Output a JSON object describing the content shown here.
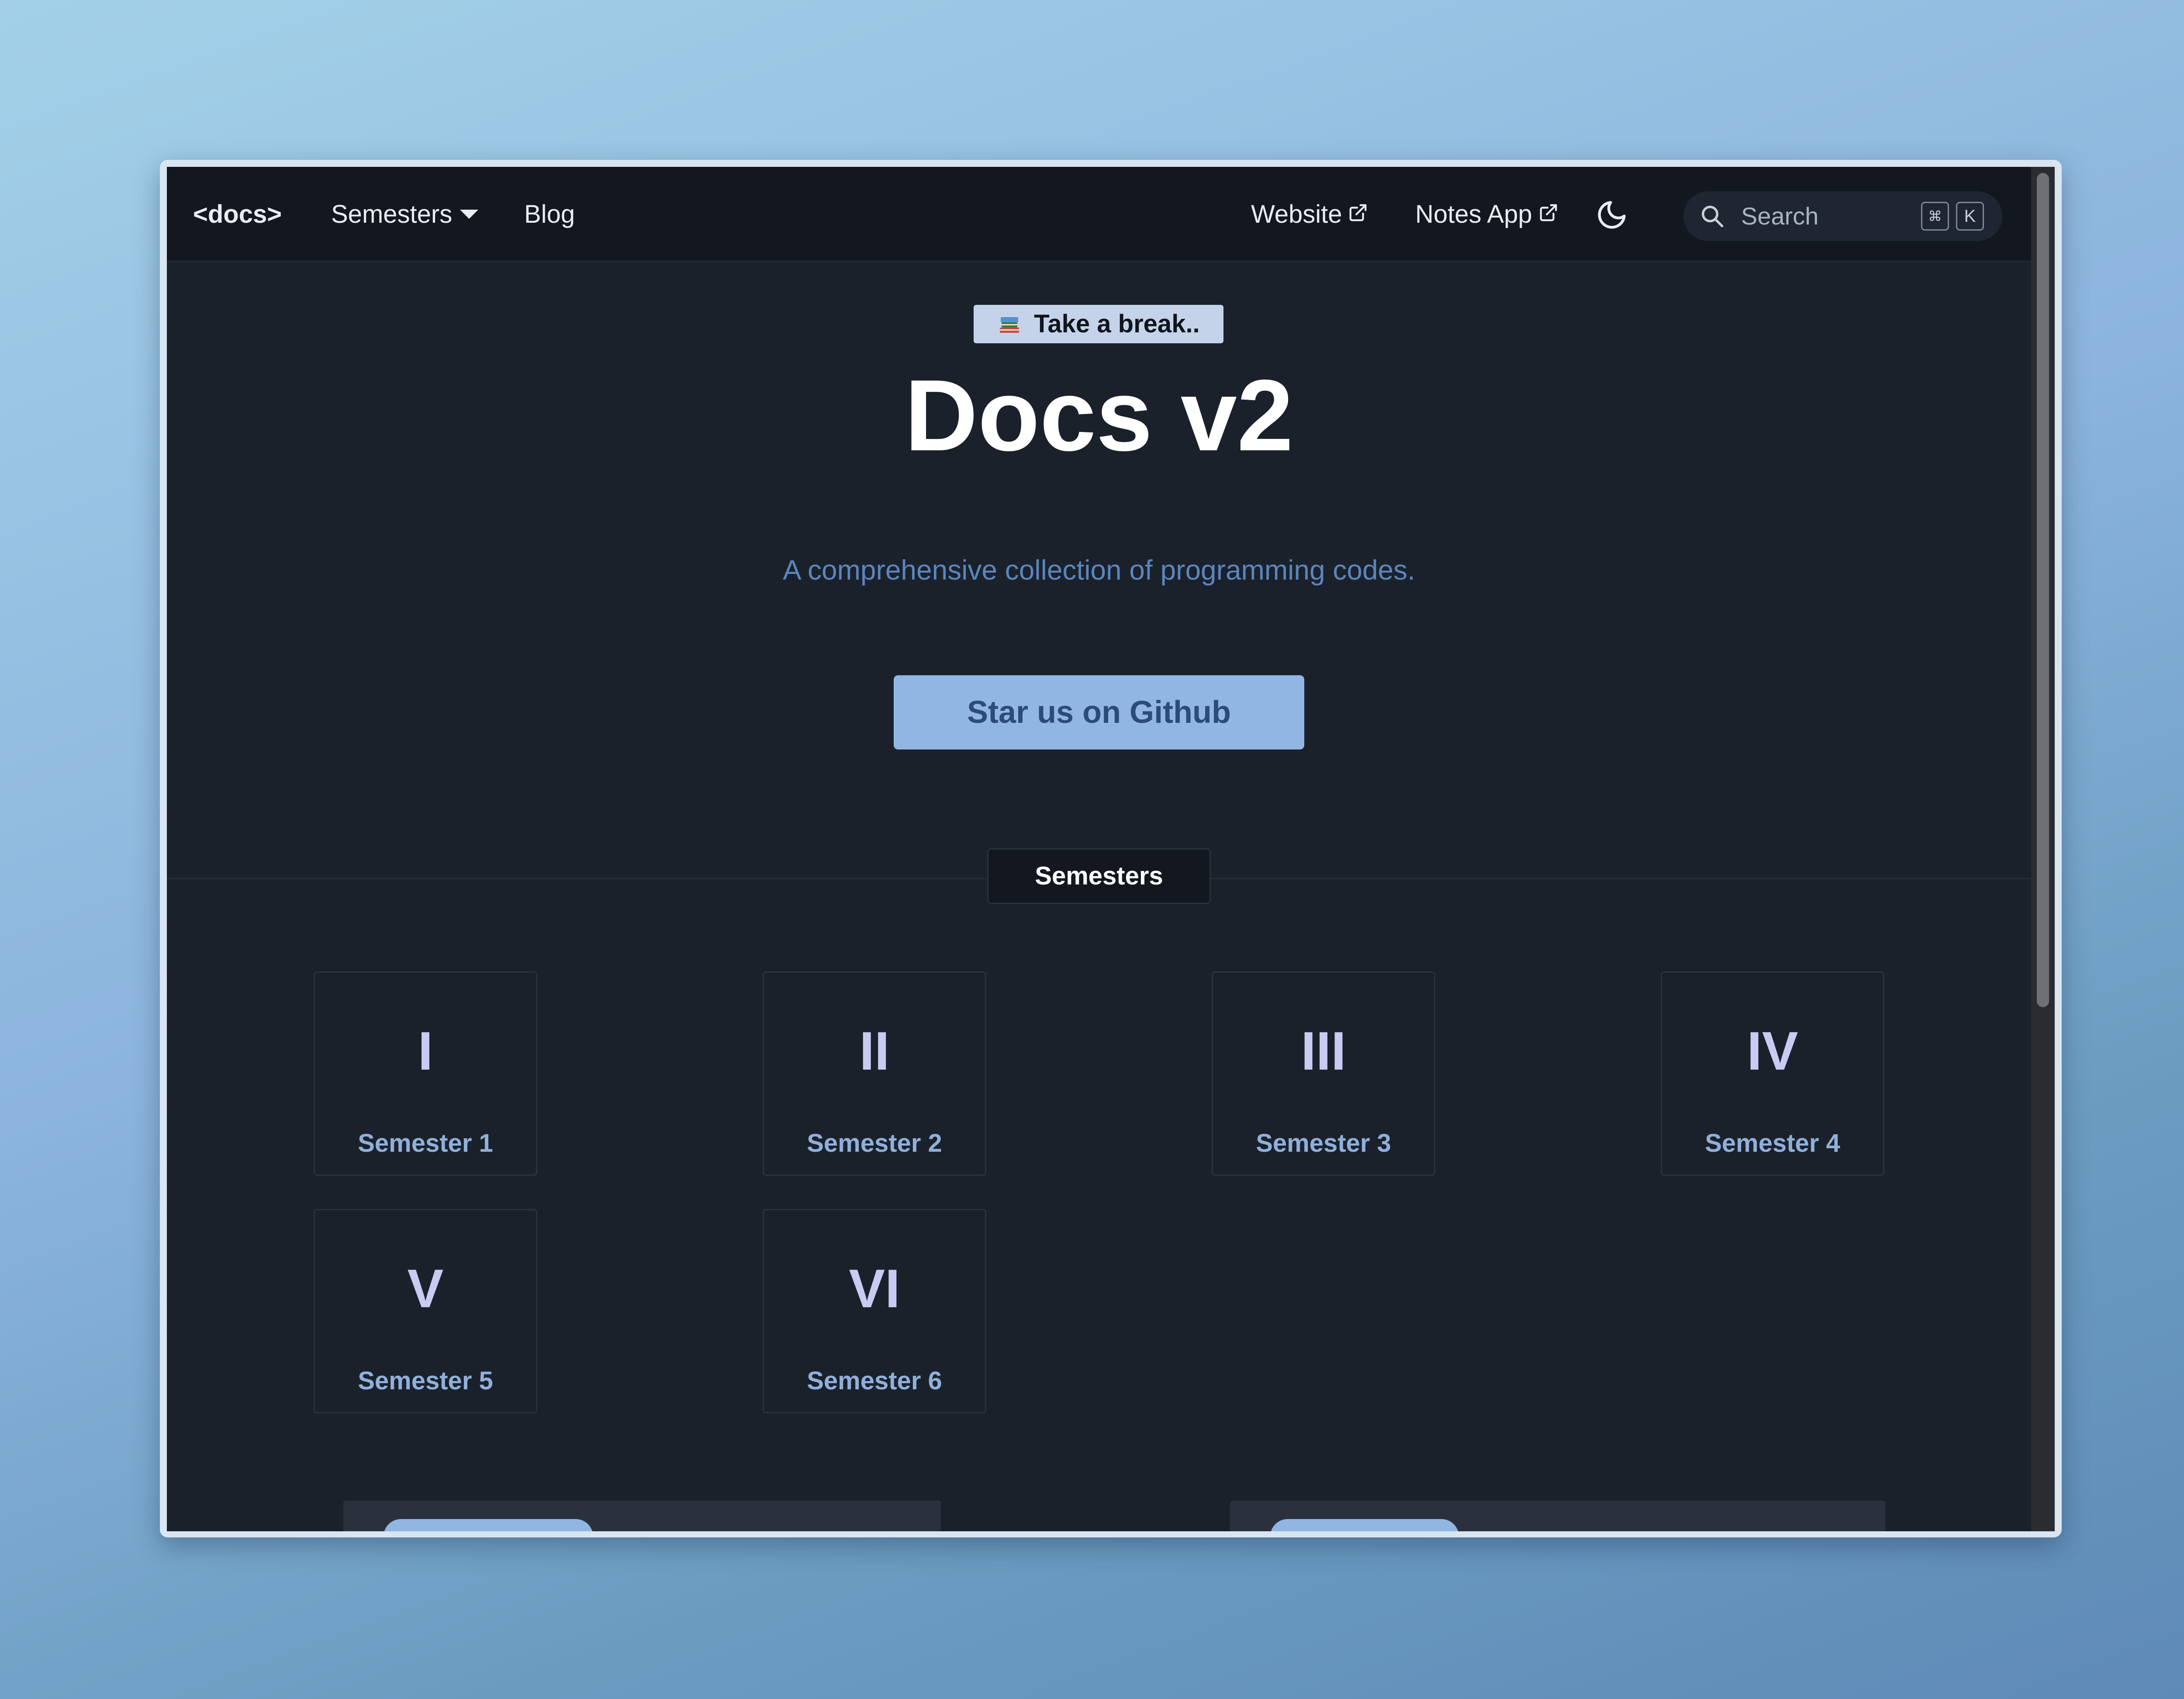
{
  "navbar": {
    "brand": "<docs>",
    "semesters_label": "Semesters",
    "blog_label": "Blog",
    "website_label": "Website",
    "notes_app_label": "Notes App",
    "search": {
      "placeholder": "Search",
      "kbd_cmd": "⌘",
      "kbd_k": "K"
    }
  },
  "hero": {
    "badge_label": "Take a break..",
    "title": "Docs v2",
    "subtitle": "A comprehensive collection of programming codes.",
    "cta_label": "Star us on Github"
  },
  "semesters_section": {
    "label": "Semesters",
    "cards": [
      {
        "numeral": "I",
        "label": "Semester 1"
      },
      {
        "numeral": "II",
        "label": "Semester 2"
      },
      {
        "numeral": "III",
        "label": "Semester 3"
      },
      {
        "numeral": "IV",
        "label": "Semester 4"
      },
      {
        "numeral": "V",
        "label": "Semester 5"
      },
      {
        "numeral": "VI",
        "label": "Semester 6"
      }
    ]
  },
  "icons": {
    "external_link": "external-link-icon",
    "theme": "moon-icon",
    "search": "search-icon",
    "badge": "books-icon"
  },
  "colors": {
    "page_background": "#1b212b",
    "navbar_background": "#131820",
    "accent": "#91b6e3",
    "subtitle": "#5a86bd",
    "numeral": "#cbcaf2"
  }
}
